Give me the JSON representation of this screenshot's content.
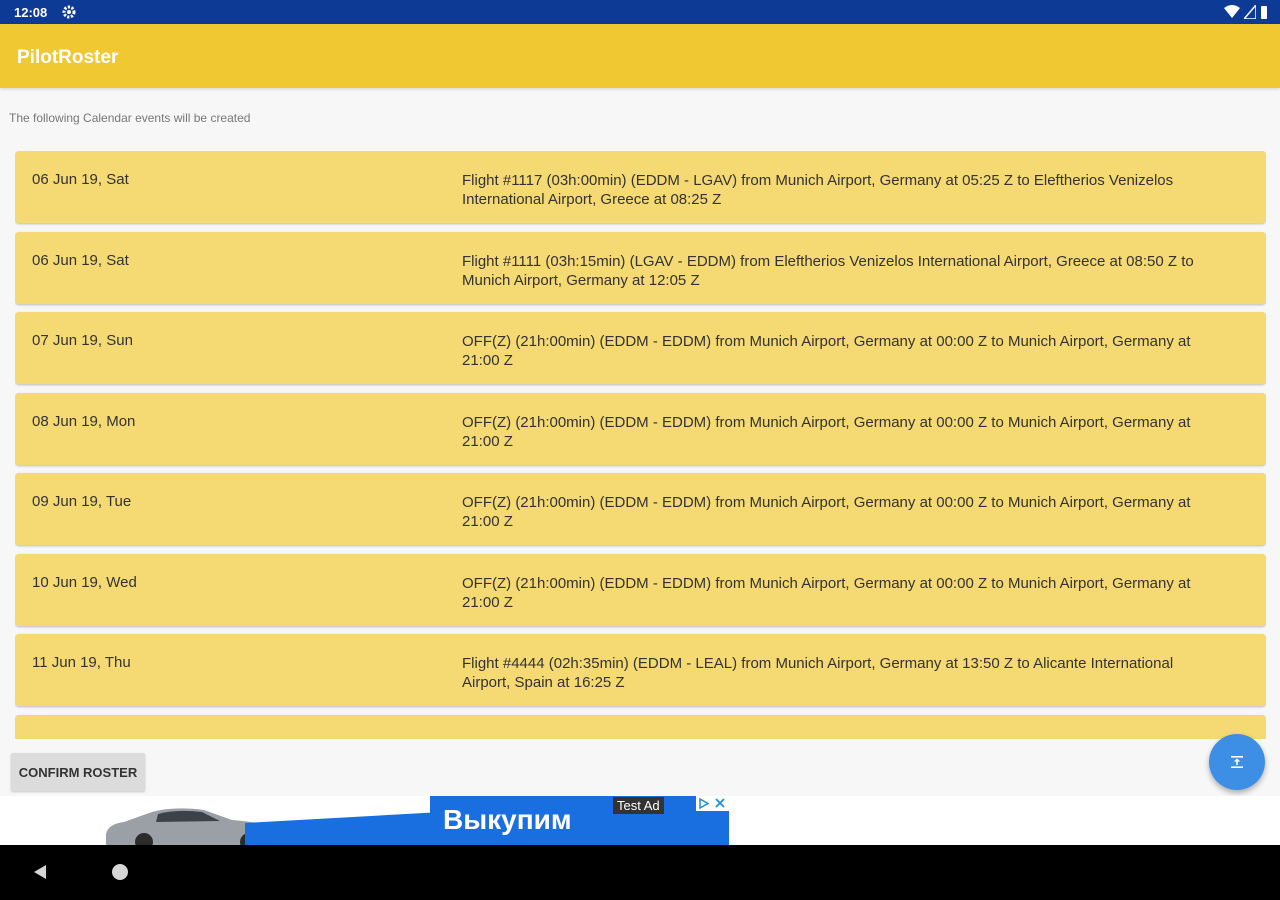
{
  "status_bar": {
    "time": "12:08"
  },
  "app_bar": {
    "title": "PilotRoster"
  },
  "subtitle": "The following Calendar events will be created",
  "events": [
    {
      "date": "06 Jun 19, Sat",
      "description": "Flight #1117 (03h:00min) (EDDM - LGAV) from Munich Airport, Germany at 05:25 Z to Eleftherios Venizelos International Airport, Greece at 08:25 Z"
    },
    {
      "date": "06 Jun 19, Sat",
      "description": "Flight #1111 (03h:15min) (LGAV - EDDM) from Eleftherios Venizelos International Airport, Greece at 08:50 Z to Munich Airport, Germany at 12:05 Z"
    },
    {
      "date": "07 Jun 19, Sun",
      "description": "OFF(Z) (21h:00min) (EDDM - EDDM) from Munich Airport, Germany at 00:00 Z to Munich Airport, Germany at 21:00 Z"
    },
    {
      "date": "08 Jun 19, Mon",
      "description": "OFF(Z) (21h:00min) (EDDM - EDDM) from Munich Airport, Germany at 00:00 Z to Munich Airport, Germany at 21:00 Z"
    },
    {
      "date": "09 Jun 19, Tue",
      "description": "OFF(Z) (21h:00min) (EDDM - EDDM) from Munich Airport, Germany at 00:00 Z to Munich Airport, Germany at 21:00 Z"
    },
    {
      "date": "10 Jun 19, Wed",
      "description": "OFF(Z) (21h:00min) (EDDM - EDDM) from Munich Airport, Germany at 00:00 Z to Munich Airport, Germany at 21:00 Z"
    },
    {
      "date": "11 Jun 19, Thu",
      "description": "Flight #4444 (02h:35min) (EDDM - LEAL) from Munich Airport, Germany at 13:50 Z to Alicante International Airport, Spain at 16:25 Z"
    },
    {
      "date": "",
      "description": ""
    }
  ],
  "confirm_button": {
    "label": "CONFIRM ROSTER"
  },
  "ad": {
    "text": "Выкупим",
    "tag": "Test Ad"
  },
  "colors": {
    "status_bar": "#0d3a94",
    "app_bar": "#f0c932",
    "card": "#f5d972",
    "fab": "#3d8fe6",
    "ad_blue": "#1a6fe0"
  }
}
